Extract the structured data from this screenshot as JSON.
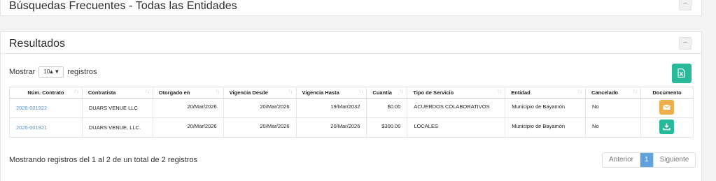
{
  "top_panel": {
    "title": "Búsquedas Frecuentes - Todas las Entidades",
    "collapse": "−"
  },
  "results_panel": {
    "title": "Resultados",
    "collapse": "−"
  },
  "length": {
    "prefix": "Mostrar",
    "value": "10",
    "suffix": "registros"
  },
  "excel_icon": "file-excel-icon",
  "table": {
    "columns": [
      "Núm. Contrato",
      "Contratista",
      "Otorgado en",
      "Vigencia Desde",
      "Vigencia Hasta",
      "Cuantía",
      "Tipo de Servicio",
      "Entidad",
      "Cancelado",
      "Documento"
    ],
    "rows": [
      {
        "contrato": "2026-001922",
        "contratista": "DUARS VENUE LLC",
        "otorgado": "20/Mar/2026",
        "desde": "20/Mar/2026",
        "hasta": "19/Mar/2032",
        "cuantia": "$0.00",
        "servicio": "ACUERDOS COLABORATIVOS",
        "entidad": "Municipio de Bayamón",
        "cancelado": "No",
        "doc_icon": "envelope-icon",
        "doc_color": "#f0ad4e"
      },
      {
        "contrato": "2026-001921",
        "contratista": "DUARS VENUE, LLC.",
        "otorgado": "20/Mar/2026",
        "desde": "20/Mar/2026",
        "hasta": "20/Mar/2026",
        "cuantia": "$300.00",
        "servicio": "LOCALES",
        "entidad": "Municipio de Bayamón",
        "cancelado": "No",
        "doc_icon": "download-icon",
        "doc_color": "#26b99a"
      }
    ]
  },
  "info": "Mostrando registros del 1 al 2 de un total de 2 registros",
  "pagination": {
    "previous": "Anterior",
    "current": "1",
    "next": "Siguiente"
  },
  "colors": {
    "accent": "#26b99a",
    "warning": "#f0ad4e",
    "link": "#5b8fc7",
    "page_active": "#5fa2dd"
  }
}
